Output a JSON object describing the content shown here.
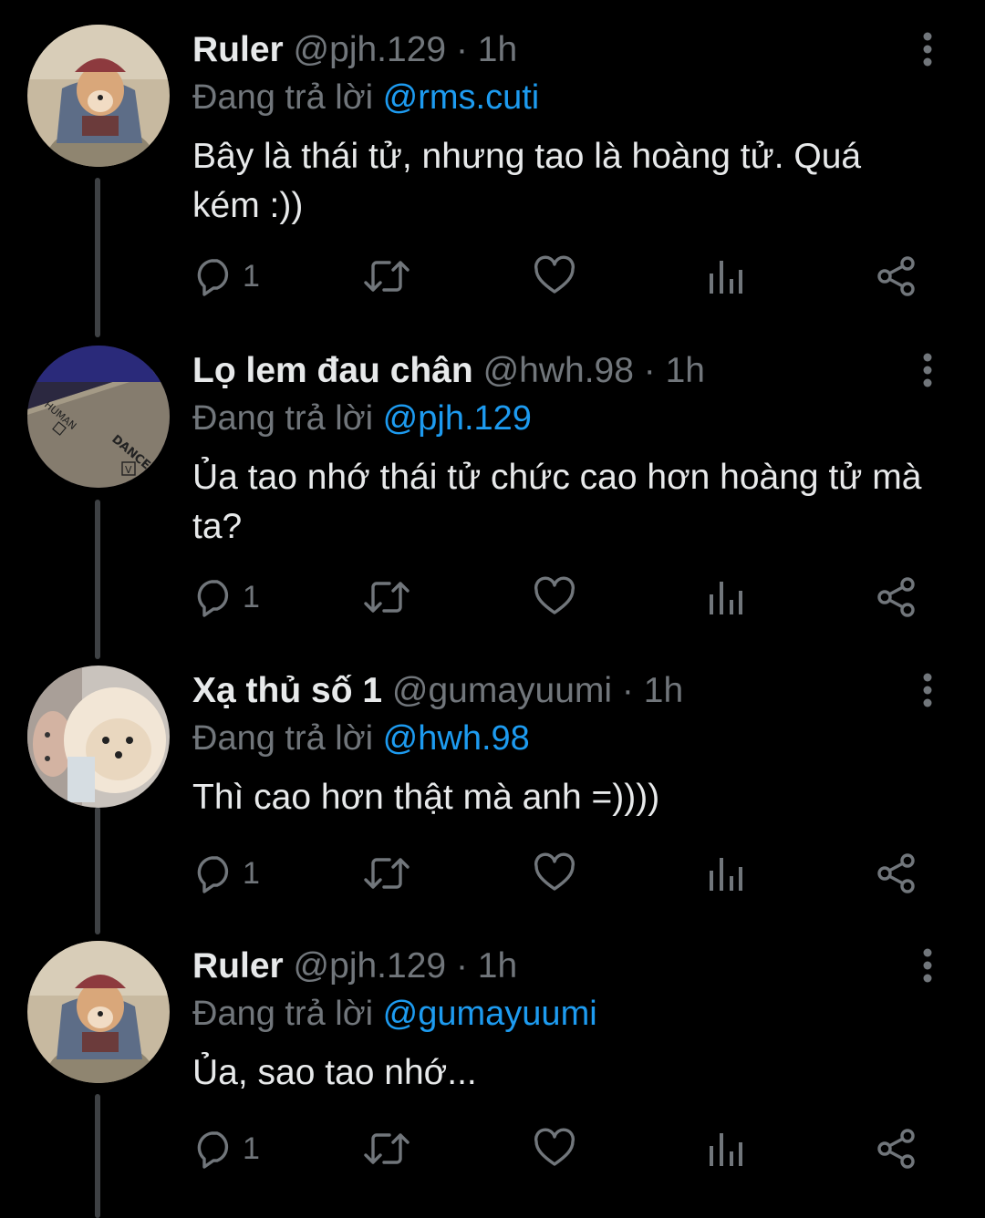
{
  "replying_prefix": "Đang trả lời",
  "separator": "·",
  "tweets": [
    {
      "name": "Ruler",
      "handle": "@pjh.129",
      "time": "1h",
      "replying_to": "@rms.cuti",
      "text": "Bây là thái tử, nhưng tao là hoàng tử. Quá kém :))",
      "reply_count": "1"
    },
    {
      "name": "Lọ lem đau chân",
      "handle": "@hwh.98",
      "time": "1h",
      "replying_to": "@pjh.129",
      "text": "Ủa tao nhớ thái tử chức cao hơn hoàng tử mà ta?",
      "reply_count": "1",
      "avatar_text": {
        "a": "HUMAN",
        "b": "DANCE",
        "c": "V"
      }
    },
    {
      "name": "Xạ thủ số 1",
      "handle": "@gumayuumi",
      "time": "1h",
      "replying_to": "@hwh.98",
      "text": "Thì cao hơn thật mà anh =))))",
      "reply_count": "1"
    },
    {
      "name": "Ruler",
      "handle": "@pjh.129",
      "time": "1h",
      "replying_to": "@gumayuumi",
      "text": "Ủa, sao tao nhớ...",
      "reply_count": "1"
    }
  ],
  "colors": {
    "background": "#000000",
    "text": "#e7e9ea",
    "secondary": "#71767b",
    "mention": "#1d9bf0",
    "thread_line": "#3e4144"
  },
  "icons": [
    "reply-icon",
    "retweet-icon",
    "like-icon",
    "views-icon",
    "share-icon",
    "more-icon"
  ]
}
